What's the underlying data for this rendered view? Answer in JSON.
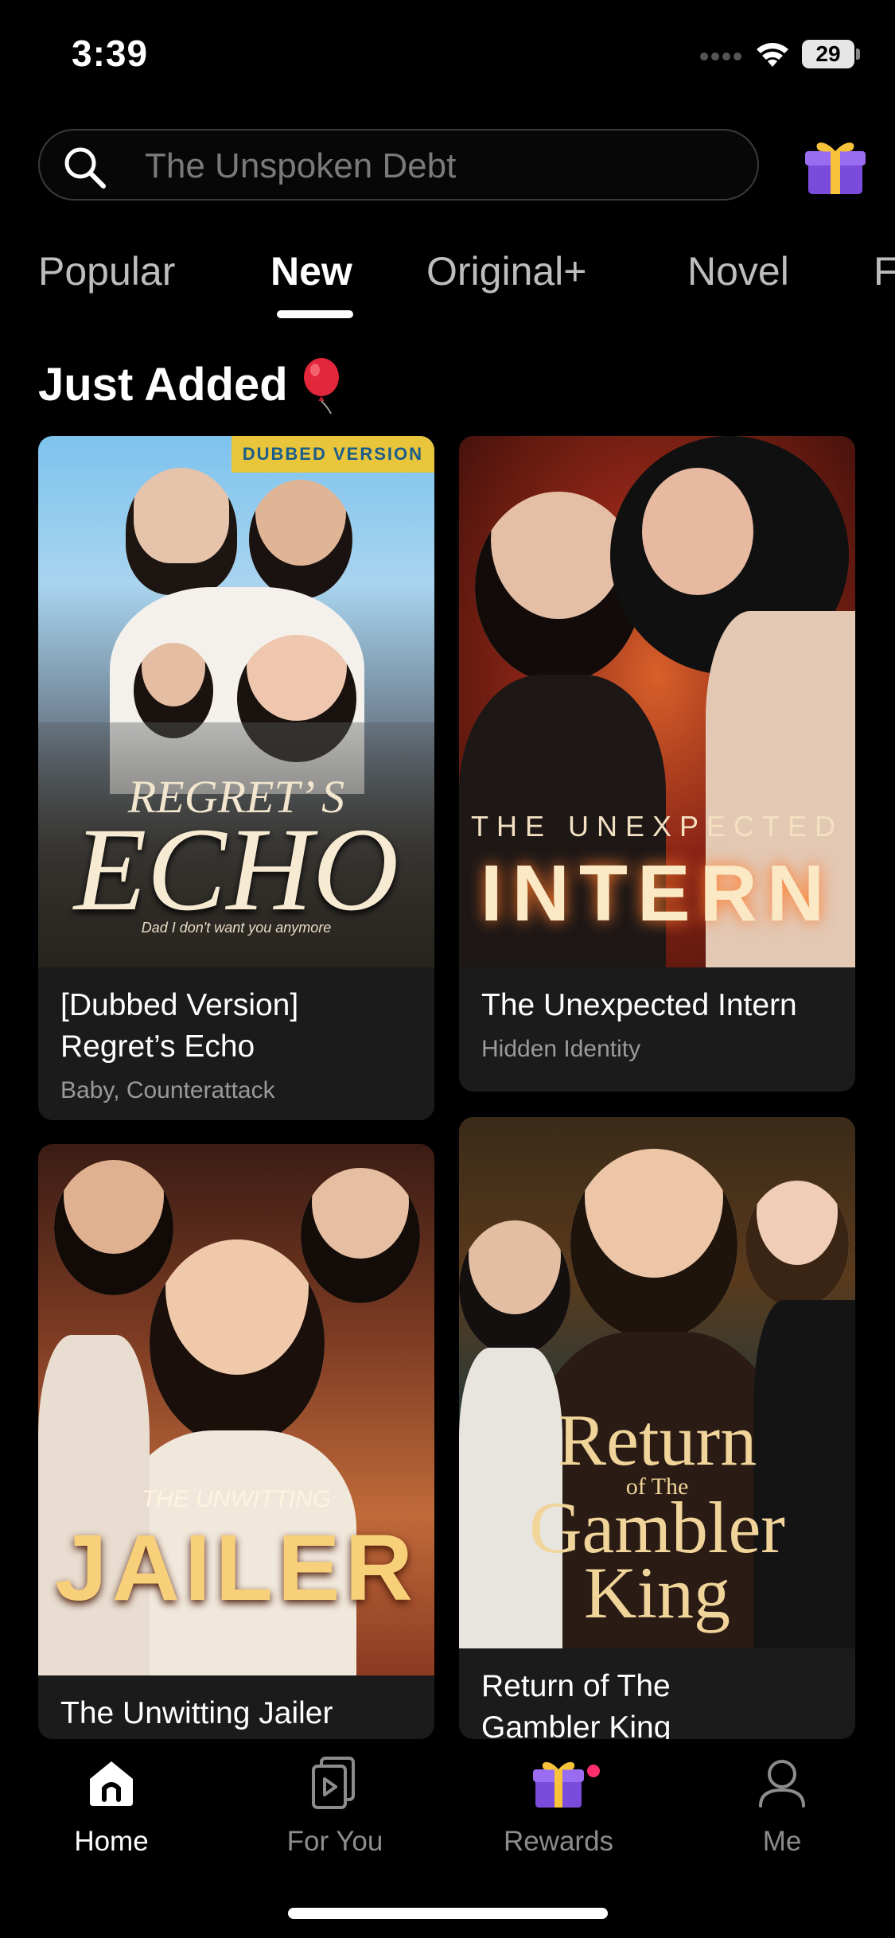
{
  "status_bar": {
    "time": "3:39",
    "battery": "29"
  },
  "search": {
    "placeholder": "The Unspoken Debt"
  },
  "tabs": [
    {
      "label": "Popular",
      "active": false
    },
    {
      "label": "New",
      "active": true
    },
    {
      "label": "Original+",
      "active": false
    },
    {
      "label": "Novel",
      "active": false
    },
    {
      "label": "F",
      "active": false
    }
  ],
  "section": {
    "title": "Just Added"
  },
  "cards": [
    {
      "title_line1": "[Dubbed Version]",
      "title_line2": "Regret’s Echo",
      "tags": "Baby, Counterattack",
      "poster": {
        "badge": "DUBBED VERSION",
        "title_top": "REGRET’ S",
        "title_main": "ECHO",
        "tagline": "Dad I don't want you anymore"
      }
    },
    {
      "title_line1": "The Unexpected Intern",
      "tags": "Hidden Identity",
      "poster": {
        "title_top": "THE UNEXPECTED",
        "title_main": "INTERN"
      }
    },
    {
      "title_line1": "The Unwitting Jailer",
      "poster": {
        "title_top": "THE UNWITTING",
        "title_main": "JAILER"
      }
    },
    {
      "title_line1": "Return of The",
      "title_line2": "Gambler King",
      "poster": {
        "line1": "Return",
        "line2": "of The",
        "line3": "Gambler",
        "line4": "King"
      }
    }
  ],
  "bottom_nav": [
    {
      "label": "Home",
      "icon": "home-icon",
      "active": true
    },
    {
      "label": "For You",
      "icon": "for-you-icon",
      "active": false
    },
    {
      "label": "Rewards",
      "icon": "gift-icon",
      "active": false
    },
    {
      "label": "Me",
      "icon": "profile-icon",
      "active": false
    }
  ],
  "colors": {
    "background": "#000000",
    "card": "#1b1b1b",
    "badge_dot": "#ff2e6c"
  }
}
